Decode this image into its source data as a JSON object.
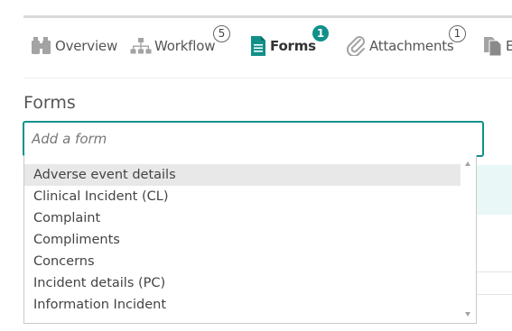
{
  "colors": {
    "accent": "#11908a",
    "text": "#444444",
    "icon": "#9a9a9a",
    "highlight": "#e8e8e8"
  },
  "tabs": [
    {
      "id": "overview",
      "label": "Overview",
      "icon": "binoculars-icon",
      "badge": null
    },
    {
      "id": "workflow",
      "label": "Workflow",
      "icon": "workflow-icon",
      "badge": "5"
    },
    {
      "id": "forms",
      "label": "Forms",
      "icon": "document-icon",
      "badge": "1",
      "active": true
    },
    {
      "id": "attachments",
      "label": "Attachments",
      "icon": "paperclip-icon",
      "badge": "1"
    },
    {
      "id": "e",
      "label": "E",
      "icon": "copy-icon",
      "badge": null
    }
  ],
  "forms_section": {
    "title": "Forms",
    "input_placeholder": "Add a form",
    "input_value": "",
    "options": [
      "Adverse event details",
      "Clinical Incident (CL)",
      "Complaint",
      "Compliments",
      "Concerns",
      "Incident details (PC)",
      "Information Incident"
    ],
    "highlighted_index": 0
  }
}
